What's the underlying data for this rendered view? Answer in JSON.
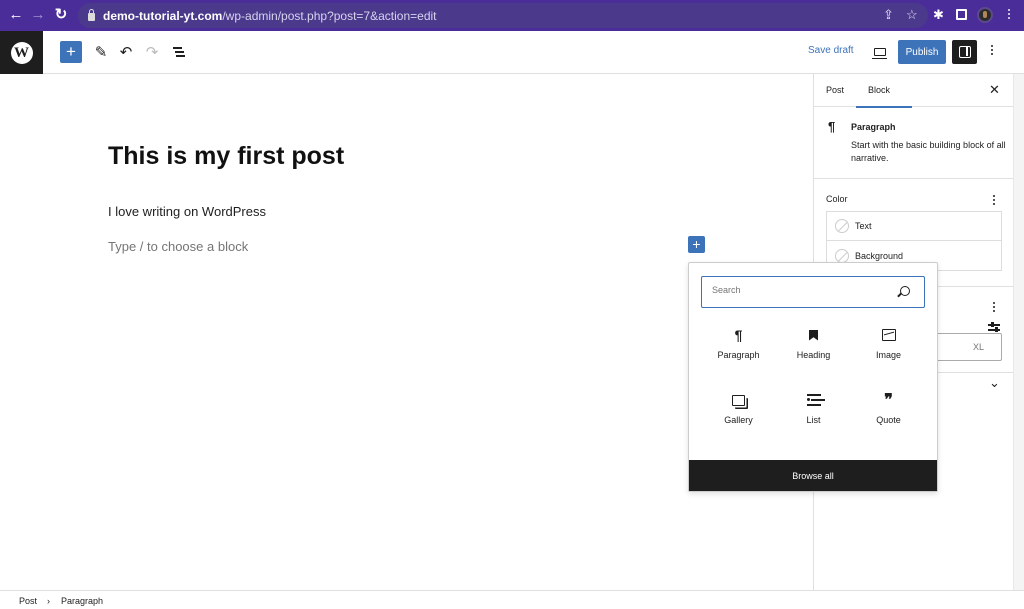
{
  "browser": {
    "url_host": "demo-tutorial-yt.com",
    "url_path": "/wp-admin/post.php?post=7&action=edit",
    "back_icon": "arrow-left-icon",
    "forward_icon": "arrow-right-icon",
    "reload_icon": "reload-icon",
    "extension_icons": [
      "share-icon",
      "star-icon",
      "puzzle-icon",
      "sidepanel-icon",
      "profile-avatar",
      "kebab-icon"
    ]
  },
  "toolbar": {
    "add_block_glyph": "+",
    "tools_glyph": "✎",
    "undo_glyph": "↶",
    "redo_glyph": "↷",
    "save_draft_label": "Save draft",
    "publish_label": "Publish"
  },
  "editor": {
    "title": "This is my first post",
    "paragraph": "I love writing on WordPress",
    "placeholder": "Type / to choose a block",
    "inline_add_glyph": "+"
  },
  "sidebar": {
    "tabs": [
      {
        "label": "Post",
        "active": false
      },
      {
        "label": "Block",
        "active": true
      }
    ],
    "close_glyph": "✕",
    "block": {
      "icon_glyph": "¶",
      "name": "Paragraph",
      "description": "Start with the basic building block of all narrative."
    },
    "color": {
      "title": "Color",
      "items": [
        {
          "label": "Text"
        },
        {
          "label": "Background"
        }
      ]
    },
    "typography": {
      "size_label": "XL"
    },
    "advanced_chevron": "⌄"
  },
  "inserter": {
    "search_placeholder": "Search",
    "search_value": "",
    "blocks": [
      {
        "label": "Paragraph",
        "icon": "paragraph-icon",
        "glyph": "¶"
      },
      {
        "label": "Heading",
        "icon": "heading-bookmark-icon",
        "glyph": ""
      },
      {
        "label": "Image",
        "icon": "image-icon",
        "glyph": ""
      },
      {
        "label": "Gallery",
        "icon": "gallery-icon",
        "glyph": ""
      },
      {
        "label": "List",
        "icon": "list-icon",
        "glyph": ""
      },
      {
        "label": "Quote",
        "icon": "quote-icon",
        "glyph": "❞"
      }
    ],
    "browse_all_label": "Browse all"
  },
  "breadcrumb": {
    "items": [
      "Post",
      "Paragraph"
    ],
    "separator": "›"
  },
  "colors": {
    "browser_bar": "#4b2d9a",
    "accent": "#3d73b8",
    "dark": "#1e1e1e"
  }
}
